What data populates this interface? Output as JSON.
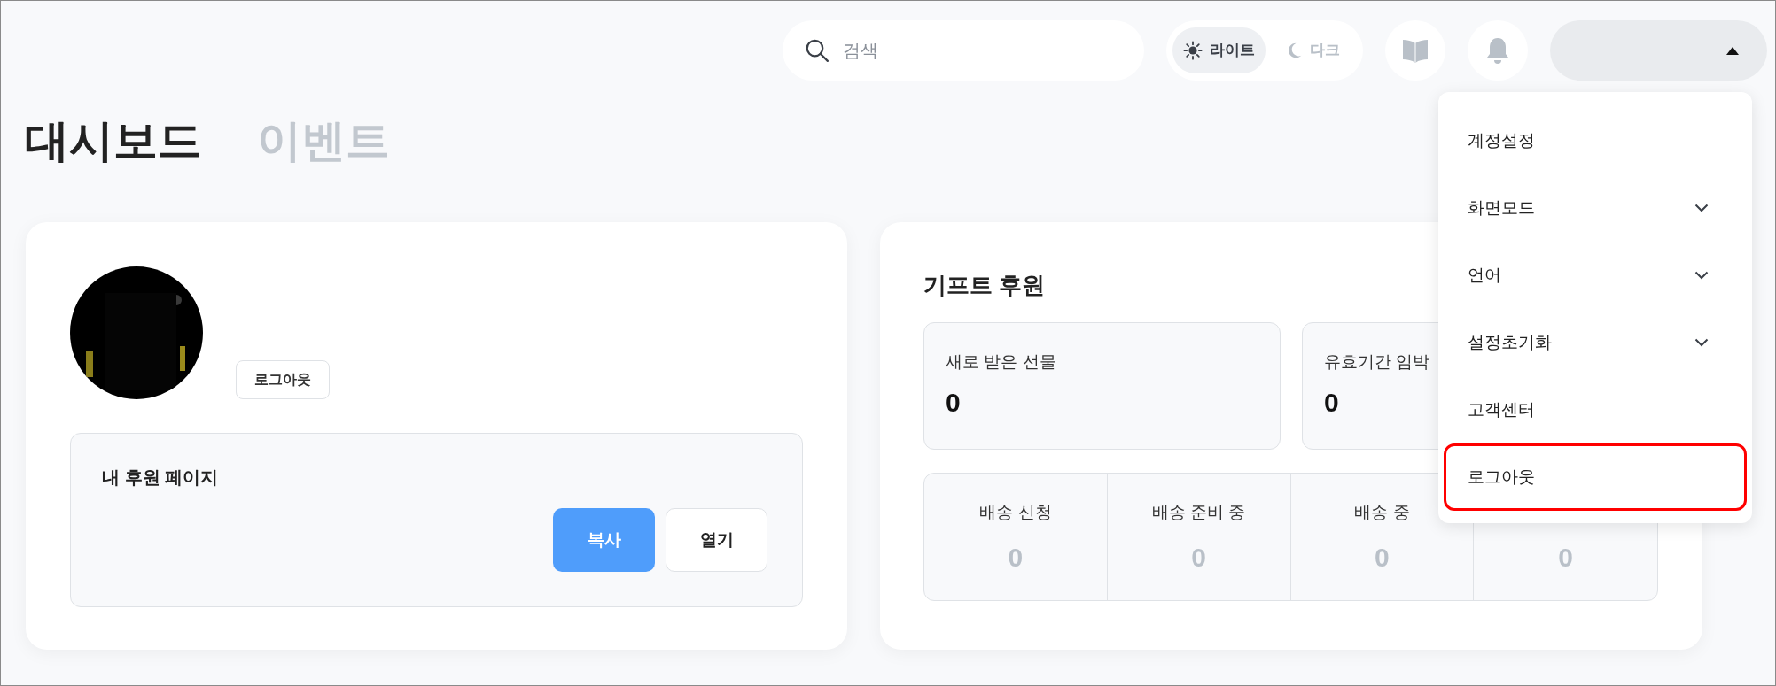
{
  "search": {
    "placeholder": "검색"
  },
  "theme_toggle": [
    {
      "label": "라이트",
      "kind": "sun",
      "selected": true
    },
    {
      "label": "다크",
      "kind": "moon",
      "selected": false
    }
  ],
  "tabs": [
    {
      "label": "대시보드",
      "selected": true
    },
    {
      "label": "이벤트",
      "selected": false
    }
  ],
  "profile_menu": {
    "expanded": true,
    "items": [
      {
        "label": "계정설정",
        "expandable": false,
        "highlighted": false
      },
      {
        "label": "화면모드",
        "expandable": true,
        "highlighted": false
      },
      {
        "label": "언어",
        "expandable": true,
        "highlighted": false
      },
      {
        "label": "설정초기화",
        "expandable": true,
        "highlighted": false
      },
      {
        "label": "고객센터",
        "expandable": false,
        "highlighted": false
      },
      {
        "label": "로그아웃",
        "expandable": false,
        "highlighted": true
      }
    ]
  },
  "profile_card": {
    "logout_button": "로그아웃",
    "sponsor_page": {
      "title": "내 후원 페이지",
      "buttons": [
        {
          "label": "복사",
          "kind": "primary"
        },
        {
          "label": "열기",
          "kind": "secondary"
        }
      ]
    }
  },
  "gift_card": {
    "title": "기프트 후원",
    "stats": [
      {
        "label": "새로 받은 선물",
        "value": "0"
      },
      {
        "label": "유효기간 임박",
        "value": "0"
      }
    ],
    "delivery": [
      {
        "label": "배송 신청",
        "value": "0"
      },
      {
        "label": "배송 준비 중",
        "value": "0"
      },
      {
        "label": "배송 중",
        "value": "0"
      },
      {
        "value": "0"
      }
    ]
  }
}
